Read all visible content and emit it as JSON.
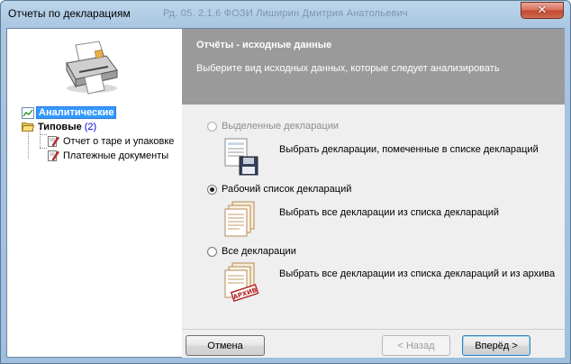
{
  "window": {
    "title": "Отчеты по декларациям",
    "title_ghost": "Рд. 05.  2.1.6   ФОЗИ Лиширин Дмитрия Анатольевич"
  },
  "tree": {
    "items": [
      {
        "label": "Аналитические",
        "selected": true
      },
      {
        "label": "Типовые",
        "count": "(2)"
      },
      {
        "label": "Отчет о таре и упаковке"
      },
      {
        "label": "Платежные документы"
      }
    ]
  },
  "header": {
    "title": "Отчёты - исходные данные",
    "subtitle": "Выберите вид исходных данных, которые следует анализировать"
  },
  "options": [
    {
      "label": "Выделенные декларации",
      "description": "Выбрать декларации, помеченные в списке деклараций",
      "checked": false,
      "disabled": true
    },
    {
      "label": "Рабочий список деклараций",
      "description": "Выбрать все декларации из списка деклараций",
      "checked": true,
      "disabled": false
    },
    {
      "label": "Все декларации",
      "description": "Выбрать все декларации из списка деклараций и из архива",
      "checked": false,
      "disabled": false
    }
  ],
  "footer": {
    "cancel_label": "Отмена",
    "back_label": "< Назад",
    "next_label": "Вперёд >"
  },
  "icons": {
    "close": "close-icon",
    "printer": "printer-icon",
    "analytics": "chart-icon",
    "folder": "folder-open-icon",
    "report": "report-pencil-icon",
    "floppy_doc": "document-floppy-icon",
    "doc_stack": "document-stack-icon",
    "archive": "archive-documents-icon"
  },
  "archive_stamp": "АРХИВ",
  "colors": {
    "header_bg": "#9a9a9a",
    "content_bg": "#efefef",
    "selection": "#3399ff",
    "count_blue": "#0000e0"
  }
}
